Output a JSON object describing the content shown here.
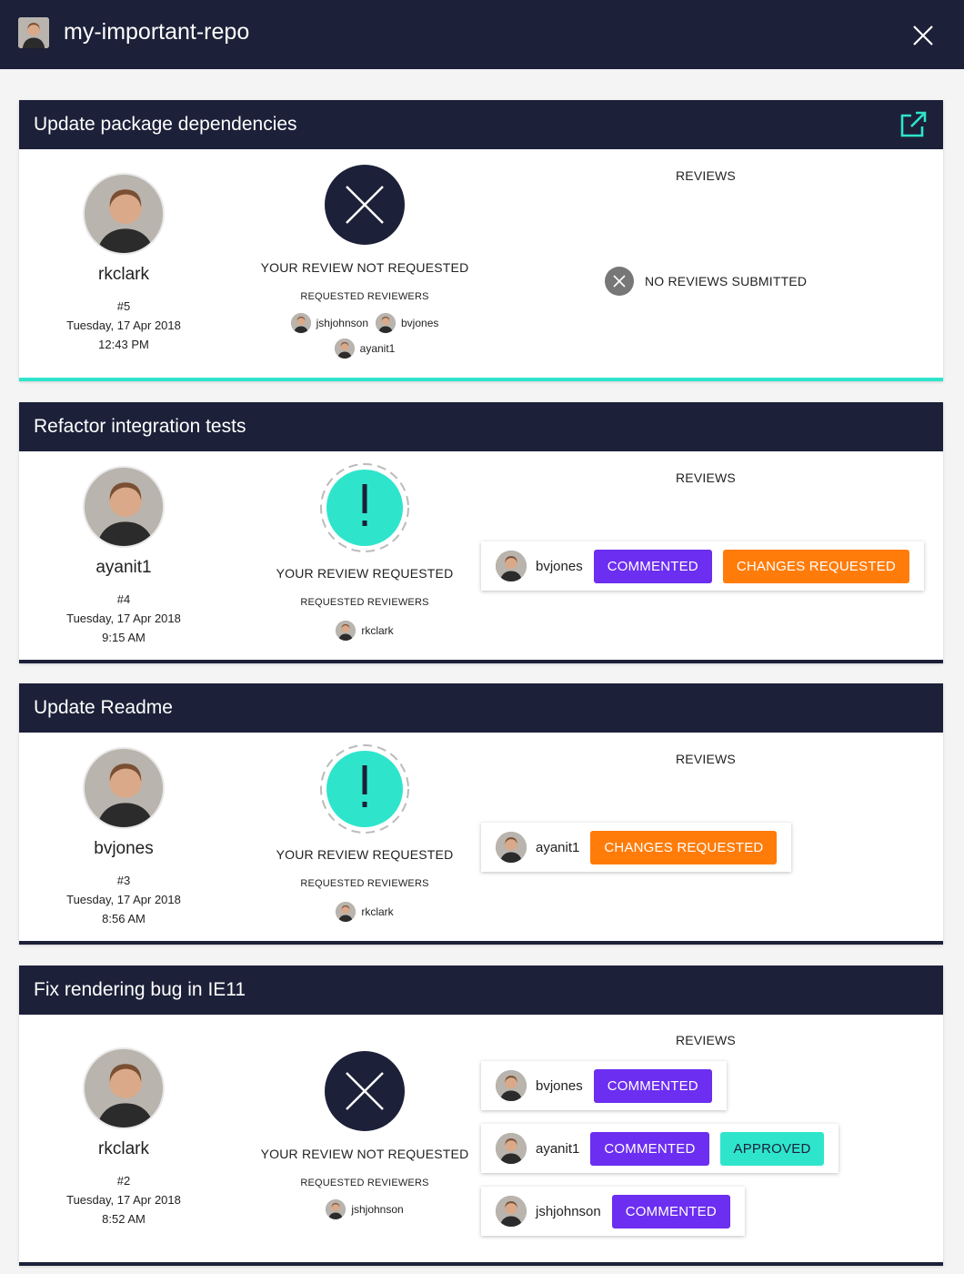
{
  "header": {
    "repo_name": "my-important-repo"
  },
  "pulls": [
    {
      "title": "Update package dependencies",
      "author": "rkclark",
      "number": "#5",
      "date": "Tuesday, 17 Apr 2018",
      "time": "12:43 PM",
      "review_status": "YOUR REVIEW NOT REQUESTED",
      "requested_reviewers_label": "REQUESTED REVIEWERS",
      "requested_reviewers": [
        "jshjohnson",
        "bvjones",
        "ayanit1"
      ],
      "reviews_label": "REVIEWS",
      "no_reviews_text": "NO REVIEWS SUBMITTED",
      "reviews": []
    },
    {
      "title": "Refactor integration tests",
      "author": "ayanit1",
      "number": "#4",
      "date": "Tuesday, 17 Apr 2018",
      "time": "9:15 AM",
      "review_status": "YOUR REVIEW REQUESTED",
      "requested_reviewers_label": "REQUESTED REVIEWERS",
      "requested_reviewers": [
        "rkclark"
      ],
      "reviews_label": "REVIEWS",
      "reviews": [
        {
          "reviewer": "bvjones",
          "states": [
            "COMMENTED",
            "CHANGES REQUESTED"
          ]
        }
      ]
    },
    {
      "title": "Update Readme",
      "author": "bvjones",
      "number": "#3",
      "date": "Tuesday, 17 Apr 2018",
      "time": "8:56 AM",
      "review_status": "YOUR REVIEW REQUESTED",
      "requested_reviewers_label": "REQUESTED REVIEWERS",
      "requested_reviewers": [
        "rkclark"
      ],
      "reviews_label": "REVIEWS",
      "reviews": [
        {
          "reviewer": "ayanit1",
          "states": [
            "CHANGES REQUESTED"
          ]
        }
      ]
    },
    {
      "title": "Fix rendering bug in IE11",
      "author": "rkclark",
      "number": "#2",
      "date": "Tuesday, 17 Apr 2018",
      "time": "8:52 AM",
      "review_status": "YOUR REVIEW NOT REQUESTED",
      "requested_reviewers_label": "REQUESTED REVIEWERS",
      "requested_reviewers": [
        "jshjohnson"
      ],
      "reviews_label": "REVIEWS",
      "reviews": [
        {
          "reviewer": "bvjones",
          "states": [
            "COMMENTED"
          ]
        },
        {
          "reviewer": "ayanit1",
          "states": [
            "COMMENTED",
            "APPROVED"
          ]
        },
        {
          "reviewer": "jshjohnson",
          "states": [
            "COMMENTED"
          ]
        }
      ]
    }
  ],
  "colors": {
    "navy": "#1c2038",
    "teal": "#2ee5cc",
    "commented": "#6c2ef0",
    "changes_requested": "#ff7c0a",
    "approved": "#2ee5cc"
  },
  "icons": {
    "close": "close-icon",
    "external_link": "external-link-icon",
    "not_requested": "x-circle-icon",
    "requested": "exclamation-circle-icon",
    "no_reviews": "x-small-circle-icon"
  }
}
